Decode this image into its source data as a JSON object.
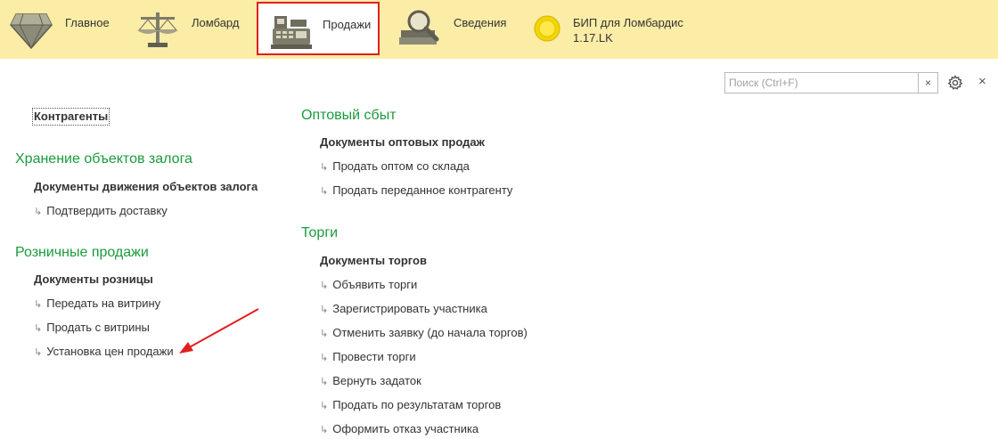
{
  "sections": {
    "main": "Главное",
    "lombard": "Ломбард",
    "sales": "Продажи",
    "info": "Сведения",
    "bip_line1": "БИП для Ломбардис",
    "bip_line2": "1.17.LK"
  },
  "search": {
    "placeholder": "Поиск (Ctrl+F)",
    "clear": "×"
  },
  "close_symbol": "×",
  "left": {
    "contractors": "Контрагенты",
    "storage": {
      "title": "Хранение объектов залога",
      "doc": "Документы движения объектов залога",
      "items": [
        "Подтвердить доставку"
      ]
    },
    "retail": {
      "title": "Розничные продажи",
      "doc": "Документы розницы",
      "items": [
        "Передать на витрину",
        "Продать с витрины",
        "Установка цен продажи"
      ]
    }
  },
  "right": {
    "wholesale": {
      "title": "Оптовый сбыт",
      "doc": "Документы оптовых продаж",
      "items": [
        "Продать оптом со склада",
        "Продать переданное контрагенту"
      ]
    },
    "auctions": {
      "title": "Торги",
      "doc": "Документы торгов",
      "items": [
        "Объявить торги",
        "Зарегистрировать участника",
        "Отменить заявку (до начала торгов)",
        "Провести торги",
        "Вернуть задаток",
        "Продать по результатам торгов",
        "Оформить отказ участника"
      ]
    }
  },
  "colors": {
    "accent_green": "#1c9a3c",
    "topbar": "#fbeca6",
    "highlight": "#e02020"
  }
}
